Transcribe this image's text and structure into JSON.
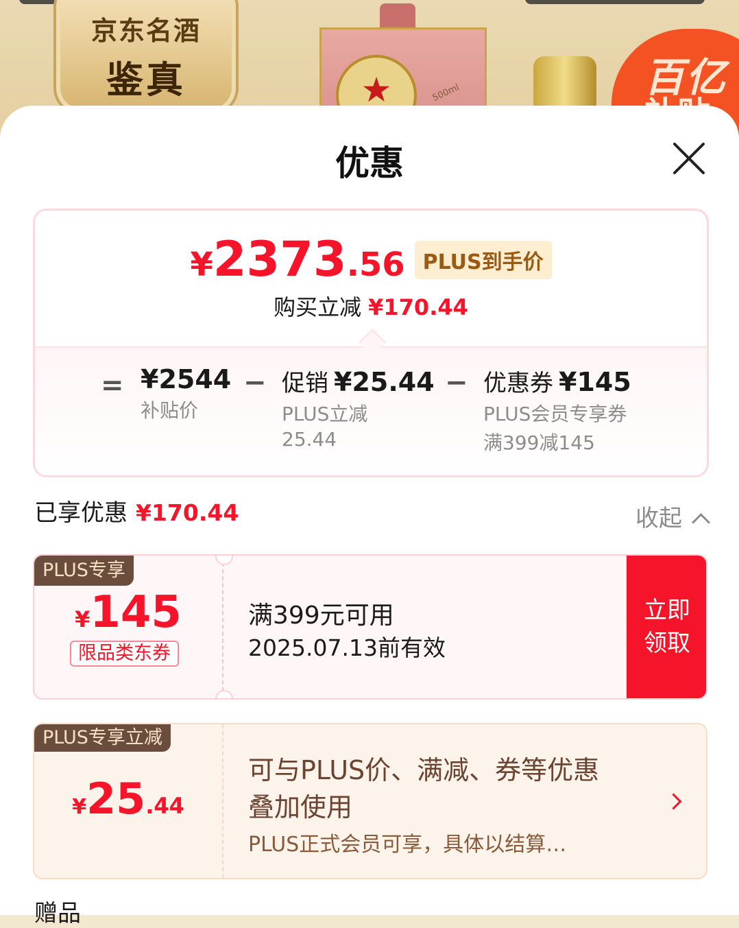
{
  "banner": {
    "jd_line1": "京东名酒",
    "jd_line2": "鉴真",
    "box_text": "500ml",
    "subsidy_line1": "百亿",
    "subsidy_line2": "补贴"
  },
  "sheet": {
    "title": "优惠",
    "close_icon": "close-icon"
  },
  "price_card": {
    "currency": "¥",
    "price_int": "2373",
    "price_dec": ".56",
    "plus_tag": "PLUS到手价",
    "save_label": "购买立减",
    "save_amount": "¥170.44",
    "equals": "=",
    "minus": "−",
    "breakdown": [
      {
        "main_label": "",
        "main_value": "¥2544",
        "sub1": "补贴价",
        "sub2": ""
      },
      {
        "main_label": "促销",
        "main_value": "¥25.44",
        "sub1": "PLUS立减",
        "sub2": "25.44"
      },
      {
        "main_label": "优惠券",
        "main_value": "¥145",
        "sub1": "PLUS会员专享券",
        "sub2": "满399减145"
      }
    ]
  },
  "enjoyed": {
    "label": "已享优惠",
    "amount": "¥170.44",
    "collapse_label": "收起"
  },
  "coupon_1": {
    "tag": "PLUS专享",
    "currency": "¥",
    "amount": "145",
    "type": "限品类东券",
    "condition": "满399元可用",
    "valid_until": "2025.07.13前有效",
    "button": "立即领取"
  },
  "coupon_2": {
    "tag": "PLUS专享立减",
    "currency": "¥",
    "amount_int": "25",
    "amount_dec": ".44",
    "line1": "可与PLUS价、满减、券等优惠",
    "line2": "叠加使用",
    "note": "PLUS正式会员可享，具体以结算…"
  },
  "next_section": {
    "partial_text": "赠品"
  },
  "colors": {
    "accent_red": "#f5142a",
    "plus_brown": "#6b4d3e",
    "plus_gold_bg": "#fdeed2"
  }
}
